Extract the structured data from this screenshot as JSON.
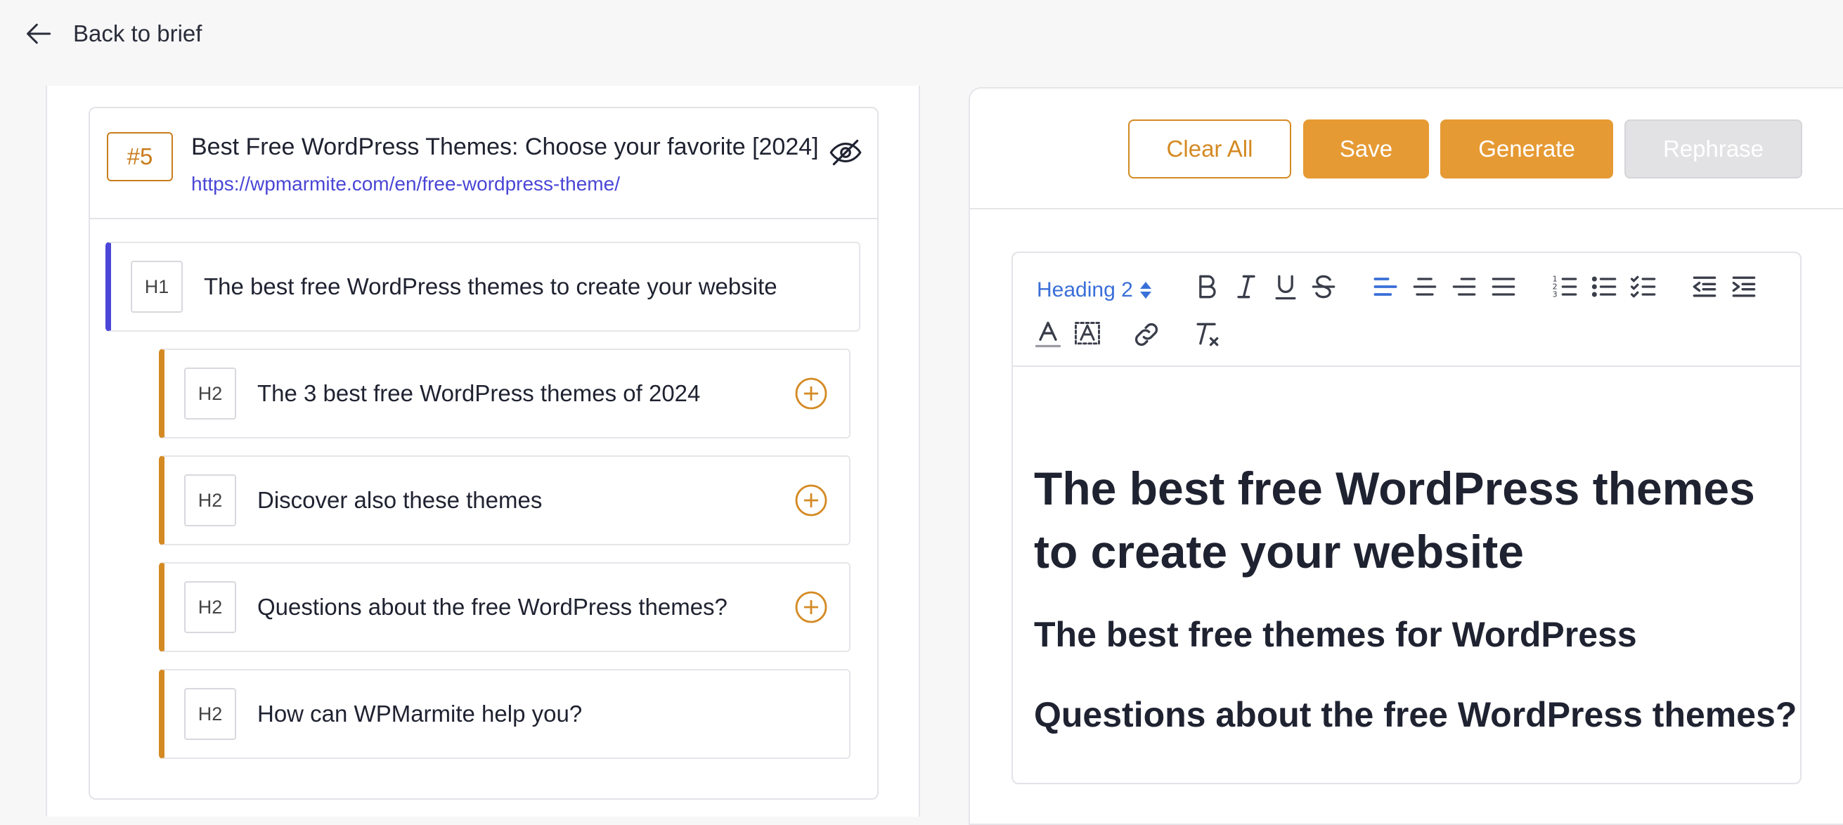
{
  "nav": {
    "back_label": "Back to brief"
  },
  "source": {
    "rank": "#5",
    "title": "Best Free WordPress Themes: Choose your favorite [2024]",
    "url": "https://wpmarmite.com/en/free-wordpress-theme/",
    "headings": [
      {
        "level": "H1",
        "text": "The best free WordPress themes to create your website",
        "has_add": false
      },
      {
        "level": "H2",
        "text": "The 3 best free WordPress themes of 2024",
        "has_add": true
      },
      {
        "level": "H2",
        "text": "Discover also these themes",
        "has_add": true
      },
      {
        "level": "H2",
        "text": "Questions about the free WordPress themes?",
        "has_add": true
      },
      {
        "level": "H2",
        "text": "How can WPMarmite help you?",
        "has_add": false
      }
    ]
  },
  "actions": {
    "clear_all": "Clear All",
    "save": "Save",
    "generate": "Generate",
    "rephrase": "Rephrase"
  },
  "editor": {
    "heading_select": "Heading 2",
    "toolbar_icons": [
      "bold-icon",
      "italic-icon",
      "underline-icon",
      "strikethrough-icon",
      "align-left-icon",
      "align-center-icon",
      "align-right-icon",
      "align-justify-icon",
      "ordered-list-icon",
      "bullet-list-icon",
      "checklist-icon",
      "outdent-icon",
      "indent-icon",
      "text-color-icon",
      "highlight-color-icon",
      "link-icon",
      "clear-format-icon"
    ],
    "content": {
      "h1": "The best free WordPress themes to create your website",
      "h2_1": "The best free themes for WordPress",
      "h2_2": "Questions about the free WordPress themes?"
    }
  },
  "colors": {
    "accent_orange": "#e69a33",
    "accent_blue": "#4b46d8",
    "link_blue": "#4a46d6",
    "disabled_gray": "#e2e2e4"
  }
}
